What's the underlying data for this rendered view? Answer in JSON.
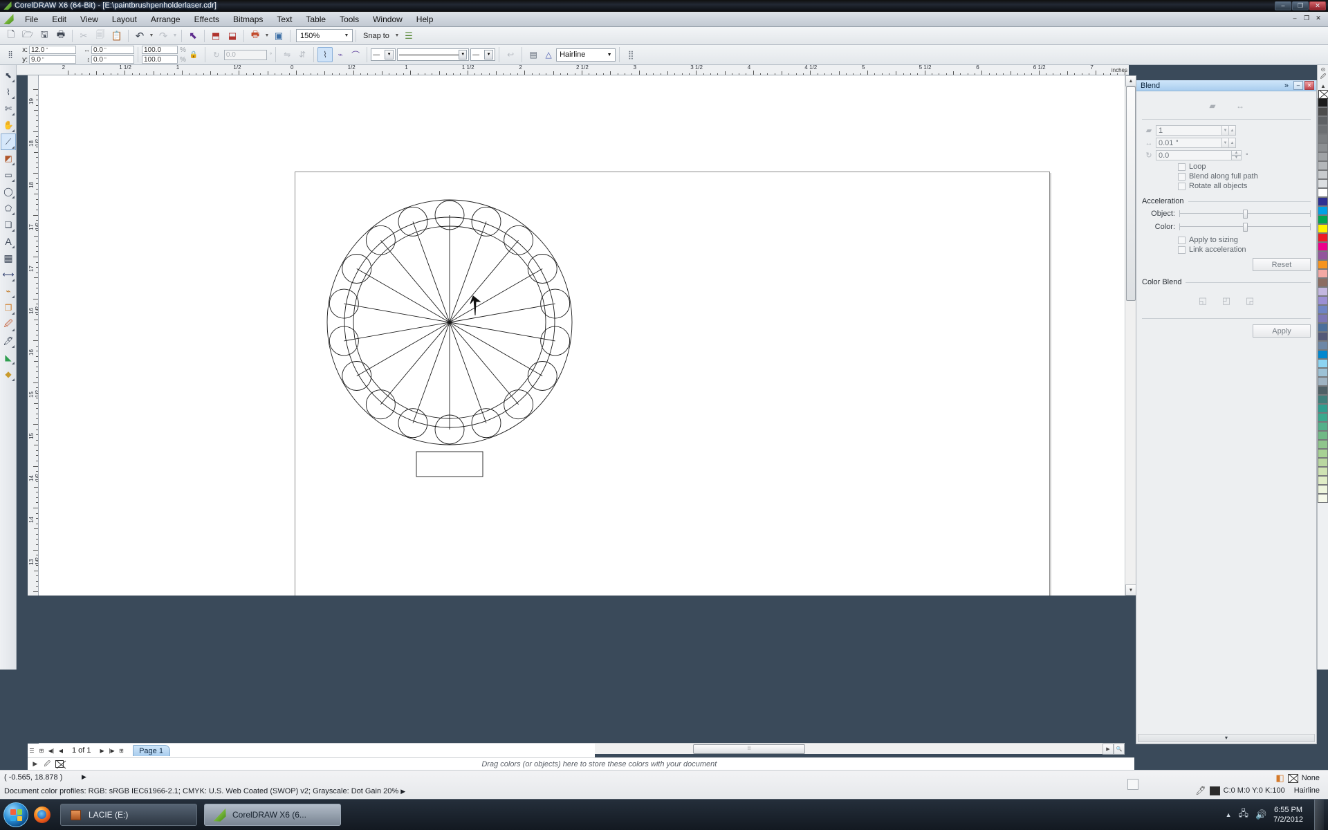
{
  "window": {
    "title": "CorelDRAW X6 (64-Bit) - [E:\\paintbrushpenholderlaser.cdr]",
    "minimize": "–",
    "maximize": "❐",
    "close": "✕",
    "inner_minimize": "–",
    "inner_restore": "❐",
    "inner_close": "✕"
  },
  "menu": {
    "items": [
      {
        "label": "File"
      },
      {
        "label": "Edit"
      },
      {
        "label": "View"
      },
      {
        "label": "Layout"
      },
      {
        "label": "Arrange"
      },
      {
        "label": "Effects"
      },
      {
        "label": "Bitmaps"
      },
      {
        "label": "Text"
      },
      {
        "label": "Table"
      },
      {
        "label": "Tools"
      },
      {
        "label": "Window"
      },
      {
        "label": "Help"
      }
    ]
  },
  "standard_toolbar": {
    "buttons": [
      {
        "name": "new-document-button",
        "glyph": "🗋"
      },
      {
        "name": "open-document-button",
        "glyph": "🗁"
      },
      {
        "name": "save-document-button",
        "glyph": "🖫"
      },
      {
        "name": "print-button",
        "glyph": "🖶"
      },
      {
        "name": "cut-button",
        "glyph": "✂"
      },
      {
        "name": "copy-button",
        "glyph": "🗐"
      },
      {
        "name": "paste-button",
        "glyph": "📋"
      },
      {
        "name": "undo-button",
        "glyph": "↶"
      },
      {
        "name": "redo-button",
        "glyph": "↷"
      },
      {
        "name": "import-button",
        "glyph": "⬒"
      },
      {
        "name": "export-button",
        "glyph": "⬓"
      },
      {
        "name": "publish-pdf-button",
        "glyph": "🗔"
      },
      {
        "name": "application-launcher-button",
        "glyph": "▣"
      }
    ],
    "zoom_level": "150%",
    "snap_to_label": "Snap to",
    "options_tooltip": "Options"
  },
  "property_bar": {
    "x_label": "x:",
    "y_label": "y:",
    "x_value": "12.0",
    "y_value": "9.0",
    "unit": "\"",
    "width_value": "0.0",
    "height_value": "0.0",
    "scale_h": "100.0",
    "scale_v": "100.0",
    "percent_symbol": "%",
    "rotation": "0.0",
    "degree_symbol": "°",
    "outline_width": "Hairline",
    "arrow_start": "—",
    "line_style": "————————",
    "arrow_end": "—"
  },
  "toolbox": {
    "tools": [
      {
        "name": "pick-tool",
        "glyph": "⬉",
        "active": false
      },
      {
        "name": "shape-tool",
        "glyph": "⌇",
        "active": false
      },
      {
        "name": "crop-tool",
        "glyph": "✂",
        "active": false
      },
      {
        "name": "pan-tool",
        "glyph": "✋",
        "active": false
      },
      {
        "name": "freehand-curve-tool",
        "glyph": "⟋",
        "active": true
      },
      {
        "name": "smart-fill-tool",
        "glyph": "◩",
        "active": false
      },
      {
        "name": "rectangle-tool",
        "glyph": "▭",
        "active": false
      },
      {
        "name": "ellipse-tool",
        "glyph": "◯",
        "active": false
      },
      {
        "name": "polygon-tool",
        "glyph": "⬠",
        "active": false
      },
      {
        "name": "basic-shapes-tool",
        "glyph": "❏",
        "active": false
      },
      {
        "name": "text-tool",
        "glyph": "A",
        "active": false
      },
      {
        "name": "table-tool",
        "glyph": "▦",
        "active": false
      },
      {
        "name": "dimension-tool",
        "glyph": "↔",
        "active": false
      },
      {
        "name": "connector-tool",
        "glyph": "⌁",
        "active": false
      },
      {
        "name": "blend-tool",
        "glyph": "❐",
        "active": false
      },
      {
        "name": "color-eyedropper-tool",
        "glyph": "🖉",
        "active": false
      },
      {
        "name": "outline-tool",
        "glyph": "🖊",
        "active": false
      },
      {
        "name": "fill-tool",
        "glyph": "🪣",
        "active": false
      },
      {
        "name": "interactive-fill-tool",
        "glyph": "◆",
        "active": false
      }
    ]
  },
  "rulers": {
    "unit_label": "inches",
    "horizontal_labels": [
      "3",
      "2 1/2",
      "2",
      "1 1/2",
      "1",
      "1/2",
      "0",
      "1/2",
      "1",
      "1 1/2",
      "2",
      "2 1/2",
      "3",
      "3 1/2",
      "4",
      "4 1/2",
      "5",
      "5 1/2",
      "6",
      "6 1/2",
      "7"
    ],
    "vertical_labels": [
      "19",
      "18 1/2",
      "18",
      "17 1/2",
      "17",
      "16 1/2",
      "16",
      "15 1/2",
      "15",
      "14 1/2",
      "14",
      "13 1/2",
      "13"
    ]
  },
  "page_navigator": {
    "page_count": "1 of 1",
    "page_tab": "Page 1",
    "first_glyph": "◀|",
    "prev_glyph": "◀",
    "next_glyph": "▶",
    "last_glyph": "|▶",
    "add_page_glyph": "⊞"
  },
  "color_dock_hint": {
    "text": "Drag colors (or objects) here to store these colors with your document",
    "none_swatch": "None"
  },
  "status_bar": {
    "coordinates": "( -0.565, 18.878 )",
    "expand_glyph": "▶",
    "color_profiles": "Document color profiles: RGB: sRGB IEC61966-2.1; CMYK: U.S. Web Coated (SWOP) v2; Grayscale: Dot Gain 20%",
    "fill_value": "None",
    "outline_value": "C:0 M:0 Y:0 K:100",
    "outline_width": "Hairline"
  },
  "docker": {
    "title": "Blend",
    "chevron": "»",
    "minimize": "–",
    "close": "✕",
    "mode_buttons": [
      {
        "name": "steps-blend-mode-button",
        "glyph": "▰"
      },
      {
        "name": "spacing-blend-mode-button",
        "glyph": "↔"
      }
    ],
    "steps_value": "1",
    "spacing_value": "0.01 \"",
    "spacing_unit": "\"",
    "rotation_value": "0.0",
    "rotation_unit": "°",
    "checkboxes": [
      {
        "label": "Loop",
        "checked": false
      },
      {
        "label": "Blend along full path",
        "checked": false
      },
      {
        "label": "Rotate all objects",
        "checked": false
      }
    ],
    "acceleration_header": "Acceleration",
    "object_label": "Object:",
    "color_label": "Color:",
    "object_slider_pct": 50,
    "color_slider_pct": 50,
    "accel_checkboxes": [
      {
        "label": "Apply to sizing",
        "checked": false
      },
      {
        "label": "Link acceleration",
        "checked": false
      }
    ],
    "reset_label": "Reset",
    "color_blend_header": "Color Blend",
    "color_blend_buttons": [
      {
        "name": "direct-blend-button",
        "glyph": "◱"
      },
      {
        "name": "clockwise-blend-button",
        "glyph": "◰"
      },
      {
        "name": "counterclockwise-blend-button",
        "glyph": "◲"
      }
    ],
    "apply_label": "Apply",
    "collapse_glyph": "▼"
  },
  "palette": {
    "none_label": "None",
    "scroll_up_glyph": "▲",
    "scroll_down_glyph": "▼",
    "expand_glyph": "◀",
    "colors": [
      "#1c1c1c",
      "#4d4d4d",
      "#5f6265",
      "#6d7073",
      "#7c7f82",
      "#8c8f92",
      "#a0a3a6",
      "#b4b7ba",
      "#c8cbce",
      "#dcdfe2",
      "#ffffff",
      "#2e3192",
      "#00a1e4",
      "#00a550",
      "#fff200",
      "#ed1c24",
      "#ec008c",
      "#92569c",
      "#f7941e",
      "#f4a9a4",
      "#8c6d62",
      "#c3b7e0",
      "#9b8fd4",
      "#6f84c4",
      "#7b76b5",
      "#4c6f9b",
      "#545a78",
      "#6d87a6",
      "#0087cf",
      "#8cd4f2",
      "#9dc2d6",
      "#9fb3c2",
      "#4f6066",
      "#3f7f7b",
      "#2f9e8f",
      "#3aa98e",
      "#53b08a",
      "#70b986",
      "#8fc58c",
      "#a7d194",
      "#b9d7a0",
      "#cfe3b3",
      "#e0edc6",
      "#eef5dd",
      "#f6f9ea"
    ]
  },
  "taskbar": {
    "buttons": [
      {
        "name": "taskbar-lacie-button",
        "label": "LACIE (E:)",
        "active": false
      },
      {
        "name": "taskbar-coreldraw-button",
        "label": "CorelDRAW X6 (6...",
        "active": true
      }
    ],
    "tray": {
      "show_hidden_glyph": "▲",
      "network_glyph": "🖧",
      "volume_glyph": "🔊",
      "time": "6:55 PM",
      "date": "7/2/2012"
    }
  },
  "drawing": {
    "description": "Circular paintbrush / pen holder laser-cut template",
    "outer_ring_count": 2,
    "hole_count": 18,
    "spoke_count": 18,
    "has_bottom_rectangle": true
  }
}
